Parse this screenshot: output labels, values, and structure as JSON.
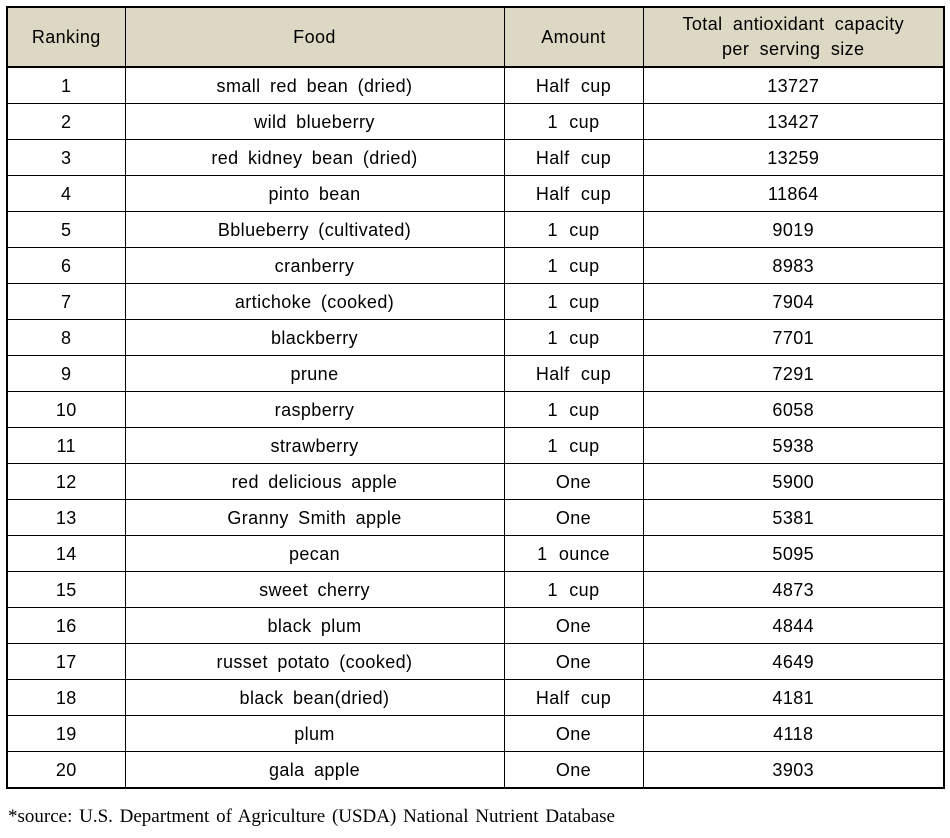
{
  "table": {
    "headers": {
      "ranking": "Ranking",
      "food": "Food",
      "amount": "Amount",
      "total_line1": "Total antioxidant capacity",
      "total_line2": "per serving size"
    },
    "columns": [
      "Ranking",
      "Food",
      "Amount",
      "Total antioxidant capacity per serving size"
    ],
    "rows": [
      {
        "ranking": "1",
        "food": "small red bean (dried)",
        "amount": "Half cup",
        "total": "13727"
      },
      {
        "ranking": "2",
        "food": "wild blueberry",
        "amount": "1 cup",
        "total": "13427"
      },
      {
        "ranking": "3",
        "food": "red kidney bean (dried)",
        "amount": "Half cup",
        "total": "13259"
      },
      {
        "ranking": "4",
        "food": "pinto bean",
        "amount": "Half cup",
        "total": "11864"
      },
      {
        "ranking": "5",
        "food": "Bblueberry (cultivated)",
        "amount": "1 cup",
        "total": "9019"
      },
      {
        "ranking": "6",
        "food": "cranberry",
        "amount": "1 cup",
        "total": "8983"
      },
      {
        "ranking": "7",
        "food": "artichoke (cooked)",
        "amount": "1 cup",
        "total": "7904"
      },
      {
        "ranking": "8",
        "food": "blackberry",
        "amount": "1 cup",
        "total": "7701"
      },
      {
        "ranking": "9",
        "food": "prune",
        "amount": "Half cup",
        "total": "7291"
      },
      {
        "ranking": "10",
        "food": "raspberry",
        "amount": "1 cup",
        "total": "6058"
      },
      {
        "ranking": "11",
        "food": "strawberry",
        "amount": "1 cup",
        "total": "5938"
      },
      {
        "ranking": "12",
        "food": "red delicious apple",
        "amount": "One",
        "total": "5900"
      },
      {
        "ranking": "13",
        "food": "Granny Smith apple",
        "amount": "One",
        "total": "5381"
      },
      {
        "ranking": "14",
        "food": "pecan",
        "amount": "1 ounce",
        "total": "5095"
      },
      {
        "ranking": "15",
        "food": "sweet cherry",
        "amount": "1 cup",
        "total": "4873"
      },
      {
        "ranking": "16",
        "food": "black plum",
        "amount": "One",
        "total": "4844"
      },
      {
        "ranking": "17",
        "food": "russet potato (cooked)",
        "amount": "One",
        "total": "4649"
      },
      {
        "ranking": "18",
        "food": "black bean(dried)",
        "amount": "Half cup",
        "total": "4181"
      },
      {
        "ranking": "19",
        "food": "plum",
        "amount": "One",
        "total": "4118"
      },
      {
        "ranking": "20",
        "food": "gala apple",
        "amount": "One",
        "total": "3903"
      }
    ]
  },
  "footnote": {
    "text": "*source: U.S. Department of Agriculture (USDA) National Nutrient Database"
  },
  "colors": {
    "header_fill": "#dcd8c3",
    "border": "#000000",
    "text": "#000000",
    "background": "#ffffff"
  }
}
